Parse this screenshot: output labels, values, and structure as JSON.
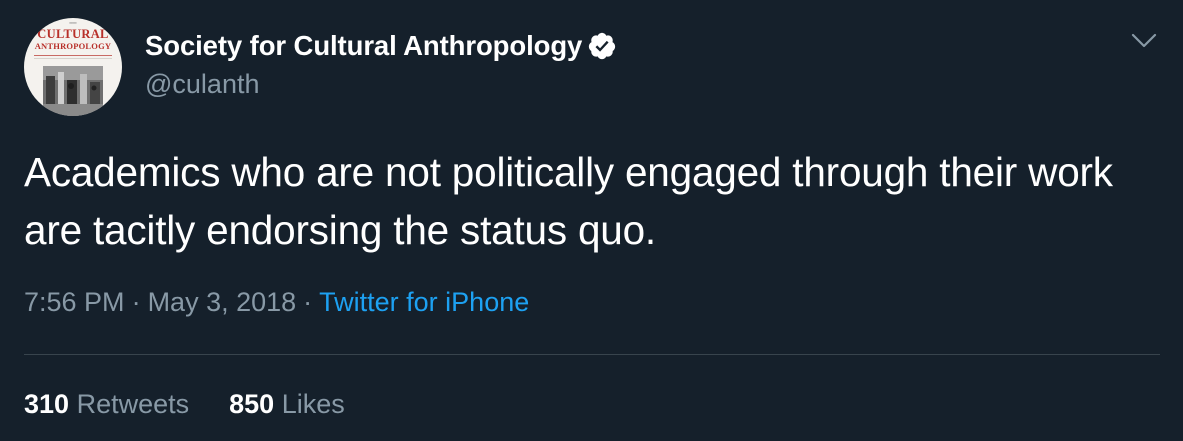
{
  "user": {
    "display_name": "Society for Cultural Anthropology",
    "handle": "@culanth",
    "verified": true,
    "avatar": {
      "logo_line1": "CULTURAL",
      "logo_line2": "ANTHROPOLOGY"
    }
  },
  "tweet": {
    "text": "Academics who are not politically engaged through their work are tacitly endorsing the status quo.",
    "time": "7:56 PM",
    "date": "May 3, 2018",
    "separator": "·",
    "source": "Twitter for iPhone"
  },
  "stats": {
    "retweets_count": "310",
    "retweets_label": "Retweets",
    "likes_count": "850",
    "likes_label": "Likes"
  },
  "icons": {
    "verified": "verified-badge-icon",
    "menu": "chevron-down-icon"
  },
  "colors": {
    "background": "#15202b",
    "primary_text": "#ffffff",
    "secondary_text": "#8899a6",
    "link": "#1da1f2",
    "divider": "#38444d"
  }
}
